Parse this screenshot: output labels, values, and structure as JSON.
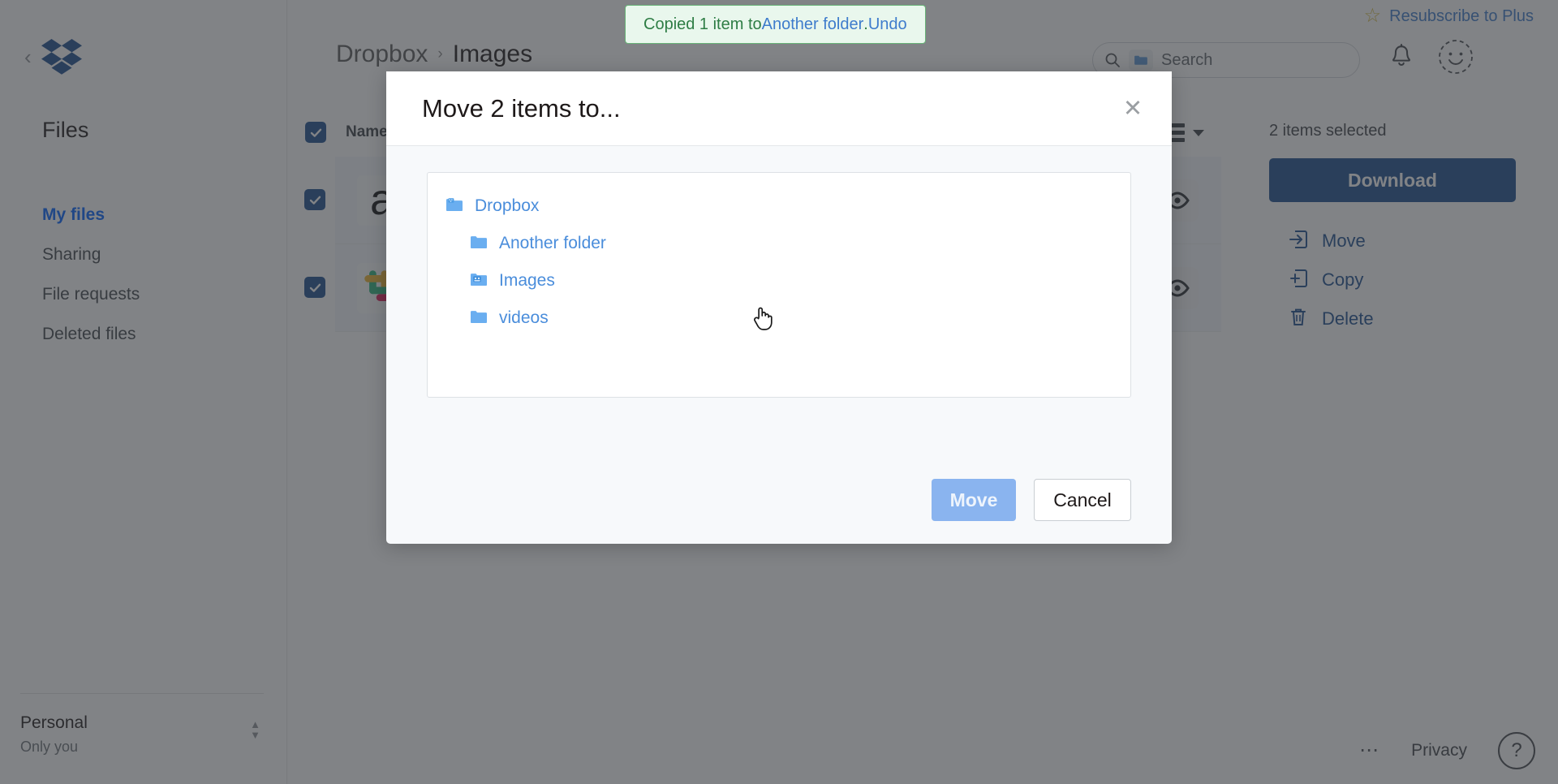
{
  "sidebar": {
    "logo": "dropbox-logo",
    "collapse_icon": "chevron-left-icon",
    "section_title": "Files",
    "items": [
      {
        "label": "My files",
        "active": true
      },
      {
        "label": "Sharing",
        "active": false
      },
      {
        "label": "File requests",
        "active": false
      },
      {
        "label": "Deleted files",
        "active": false
      }
    ],
    "account": {
      "name": "Personal",
      "subtitle": "Only you",
      "switcher_icon": "chevron-up-down-icon"
    }
  },
  "header": {
    "resubscribe": {
      "label": "Resubscribe to Plus",
      "icon": "star-icon"
    },
    "breadcrumb": [
      {
        "label": "Dropbox",
        "current": false
      },
      {
        "label": "Images",
        "current": true
      }
    ],
    "breadcrumb_separator": "›",
    "search": {
      "placeholder": "Search",
      "value": "",
      "icon": "search-icon",
      "scope_icon": "folder-icon"
    },
    "notifications_icon": "bell-icon",
    "avatar_icon": "smiley-avatar-icon"
  },
  "table": {
    "select_all_checked": true,
    "columns": [
      "Name"
    ],
    "view_icon": "list-view-icon",
    "view_caret_icon": "chevron-down-icon",
    "rows": [
      {
        "name": "",
        "thumb": "image-thumbnail",
        "checked": true,
        "end_icon": "share-icon"
      },
      {
        "name": "",
        "thumb": "slack-logo",
        "checked": true,
        "end_icon": "share-icon"
      }
    ]
  },
  "selection_panel": {
    "count_label": "2 items selected",
    "download_label": "Download",
    "actions": [
      {
        "label": "Move",
        "icon": "move-into-box-icon"
      },
      {
        "label": "Copy",
        "icon": "copy-into-box-icon"
      },
      {
        "label": "Delete",
        "icon": "trash-icon"
      }
    ]
  },
  "footer": {
    "more_icon": "ellipsis-icon",
    "privacy_label": "Privacy",
    "help_label": "?"
  },
  "toast": {
    "prefix": "Copied 1 item to ",
    "folder_link": "Another folder",
    "middle": ". ",
    "undo_link": "Undo"
  },
  "modal": {
    "title": "Move 2 items to...",
    "close_icon": "close-icon",
    "tree": [
      {
        "label": "Dropbox",
        "icon": "dropbox-folder-icon",
        "depth": 0
      },
      {
        "label": "Another folder",
        "icon": "folder-icon",
        "depth": 1
      },
      {
        "label": "Images",
        "icon": "shared-folder-icon",
        "depth": 1
      },
      {
        "label": "videos",
        "icon": "folder-icon",
        "depth": 1
      }
    ],
    "move_label": "Move",
    "move_disabled": true,
    "cancel_label": "Cancel"
  },
  "colors": {
    "brand_blue": "#0061fe",
    "dark_blue": "#1b4d8e",
    "link_blue": "#4a8ddb",
    "toast_green": "#2e7d45",
    "toast_bg": "#e9f7ed"
  },
  "cursor": {
    "type": "pointer-hand-cursor"
  }
}
